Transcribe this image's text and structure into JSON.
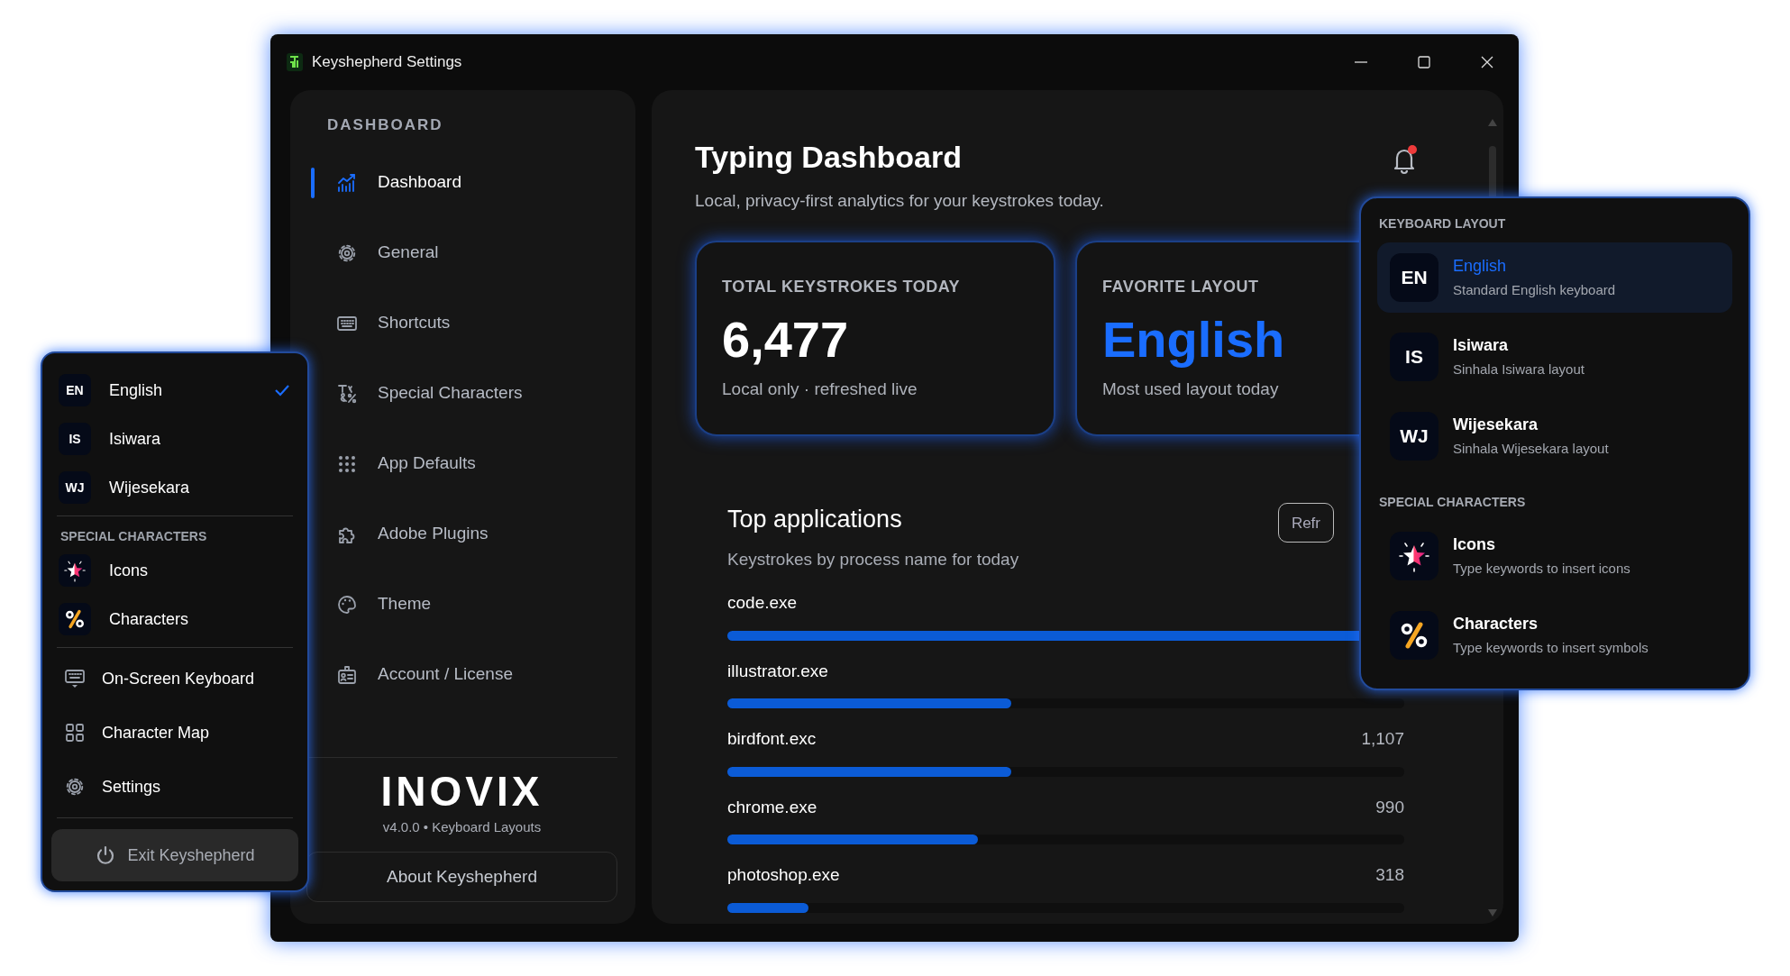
{
  "window": {
    "title": "Keyshepherd Settings"
  },
  "sidebar": {
    "heading": "DASHBOARD",
    "items": [
      {
        "label": "Dashboard",
        "selected": true
      },
      {
        "label": "General",
        "selected": false
      },
      {
        "label": "Shortcuts",
        "selected": false
      },
      {
        "label": "Special Characters",
        "selected": false
      },
      {
        "label": "App Defaults",
        "selected": false
      },
      {
        "label": "Adobe Plugins",
        "selected": false
      },
      {
        "label": "Theme",
        "selected": false
      },
      {
        "label": "Account / License",
        "selected": false
      }
    ],
    "logo": "INOVIX",
    "version": "v4.0.0 • Keyboard Layouts",
    "about_button": "About Keyshepherd"
  },
  "header": {
    "title": "Typing Dashboard",
    "subtitle": "Local, privacy-first analytics for your keystrokes today.",
    "unread": true
  },
  "stats": [
    {
      "kind": "number",
      "label": "TOTAL KEYSTROKES TODAY",
      "value": "6,477",
      "note": "Local only · refreshed live"
    },
    {
      "kind": "accent",
      "label": "FAVORITE LAYOUT",
      "value": "English",
      "note": "Most used layout today"
    }
  ],
  "top_applications": {
    "title": "Top applications",
    "subtitle": "Keystrokes by process name for today",
    "button": "Refr",
    "apps": [
      {
        "name": "code.exe",
        "level": 1.0
      },
      {
        "name": "illustrator.exe",
        "level": 0.42
      },
      {
        "name": "birdfont.exc",
        "count": "1,107",
        "level": 0.42
      },
      {
        "name": "chrome.exe",
        "count": "990",
        "level": 0.37
      },
      {
        "name": "photoshop.exe",
        "count": "318",
        "level": 0.12
      }
    ]
  },
  "layout_menu": {
    "sections": [
      {
        "heading": "KEYBOARD LAYOUT",
        "items": [
          {
            "badge": "EN",
            "title": "English",
            "subtitle": "Standard English keyboard",
            "selected": true
          },
          {
            "badge": "IS",
            "title": "Isiwara",
            "subtitle": "Sinhala Isiwara layout",
            "selected": false
          },
          {
            "badge": "WJ",
            "title": "Wijesekara",
            "subtitle": "Sinhala Wijesekara layout",
            "selected": false
          }
        ]
      },
      {
        "heading": "SPECIAL CHARACTERS",
        "items": [
          {
            "title": "Icons",
            "subtitle": "Type keywords to insert icons",
            "selected": false
          },
          {
            "title": "Characters",
            "subtitle": "Type keywords to insert symbols",
            "selected": false
          }
        ]
      }
    ]
  },
  "tray_menu": {
    "layouts": [
      {
        "badge": "EN",
        "label": "English",
        "checked": true
      },
      {
        "badge": "IS",
        "label": "Isiwara",
        "checked": false
      },
      {
        "badge": "WJ",
        "label": "Wijesekara",
        "checked": false
      }
    ],
    "special_heading": "SPECIAL CHARACTERS",
    "special": [
      {
        "label": "Icons"
      },
      {
        "label": "Characters"
      }
    ],
    "actions": [
      {
        "label": "On-Screen Keyboard"
      },
      {
        "label": "Character Map"
      },
      {
        "label": "Settings"
      }
    ],
    "exit_button": "Exit Keyshepherd"
  }
}
